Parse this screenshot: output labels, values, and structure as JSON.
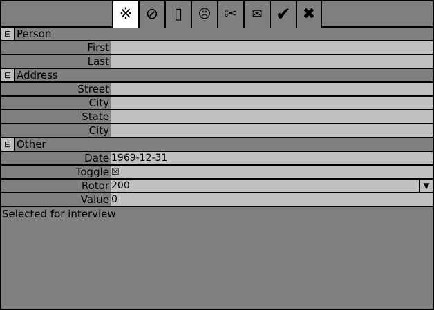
{
  "toolbar": {
    "tools": [
      {
        "icon": "asterism-icon",
        "glyph": "※",
        "active": true
      },
      {
        "icon": "prohibited-icon",
        "glyph": "⊘"
      },
      {
        "icon": "blank-icon",
        "glyph": "▯"
      },
      {
        "icon": "frown-icon",
        "glyph": "☹"
      },
      {
        "icon": "scissors-icon",
        "glyph": "✂"
      },
      {
        "icon": "envelope-icon",
        "glyph": "✉"
      },
      {
        "icon": "check-icon",
        "glyph": "✔"
      },
      {
        "icon": "x-icon",
        "glyph": "✖"
      }
    ]
  },
  "sections": {
    "person": {
      "toggle": "⊟",
      "title": "Person"
    },
    "address": {
      "toggle": "⊟",
      "title": "Address"
    },
    "other": {
      "toggle": "⊟",
      "title": "Other"
    }
  },
  "fields": {
    "first": {
      "label": "First",
      "value": ""
    },
    "last": {
      "label": "Last",
      "value": ""
    },
    "street": {
      "label": "Street",
      "value": ""
    },
    "city": {
      "label": "City",
      "value": ""
    },
    "state": {
      "label": "State",
      "value": ""
    },
    "city2": {
      "label": "City",
      "value": ""
    },
    "date": {
      "label": "Date",
      "value": "1969-12-31"
    },
    "toggle": {
      "label": "Toggle",
      "value": "☒"
    },
    "rotor": {
      "label": "Rotor",
      "value": "200",
      "dropdown": "▼"
    },
    "value": {
      "label": "Value",
      "value": "0"
    }
  },
  "status": {
    "text": "Selected for interview"
  },
  "colors": {
    "background": "#808080",
    "field": "#c0c0c0",
    "active_tool": "#ffffff",
    "border": "#000000"
  }
}
